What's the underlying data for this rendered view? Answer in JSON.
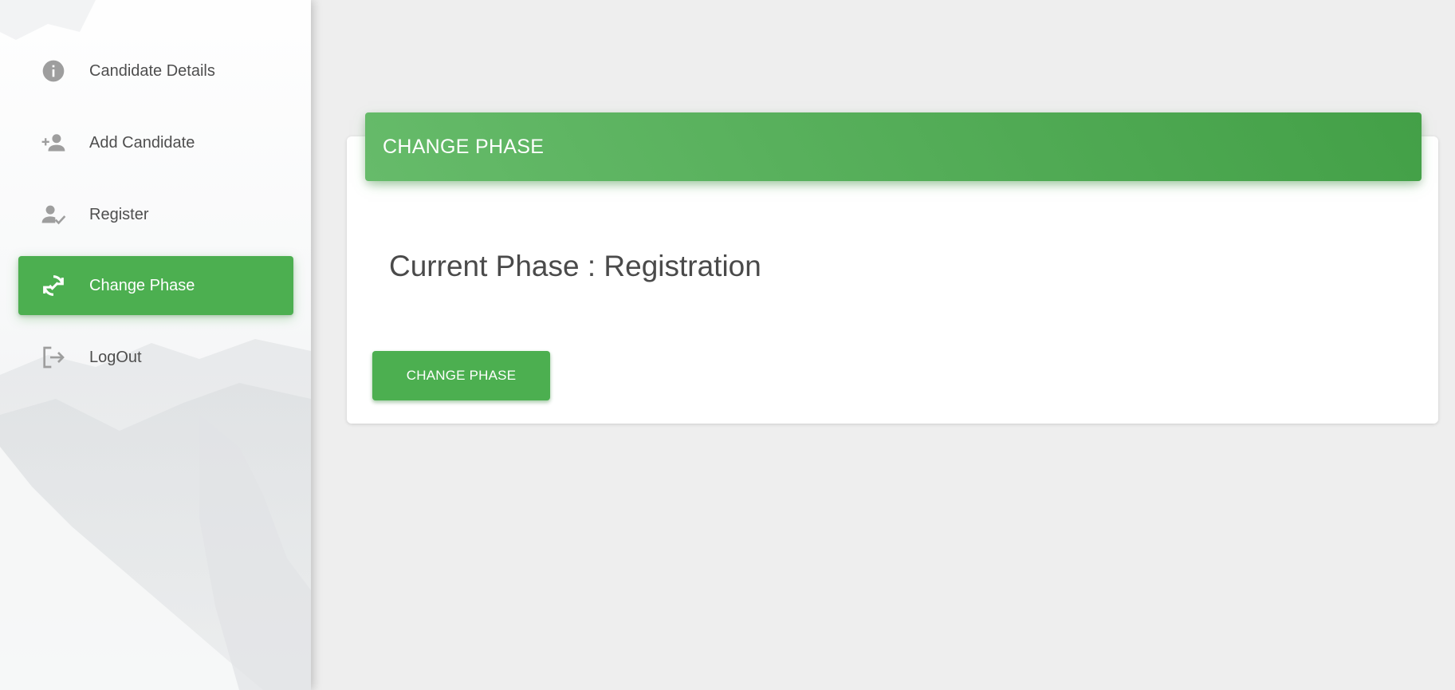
{
  "sidebar": {
    "items": [
      {
        "label": "Candidate Details",
        "icon": "info-icon",
        "active": false
      },
      {
        "label": "Add Candidate",
        "icon": "person-add-icon",
        "active": false
      },
      {
        "label": "Register",
        "icon": "person-check-icon",
        "active": false
      },
      {
        "label": "Change Phase",
        "icon": "sync-check-icon",
        "active": true
      },
      {
        "label": "LogOut",
        "icon": "logout-icon",
        "active": false
      }
    ]
  },
  "card": {
    "header_title": "CHANGE PHASE",
    "current_phase_text": "Current Phase : Registration",
    "button_label": "CHANGE PHASE"
  },
  "colors": {
    "accent": "#4caf50",
    "header_gradient_start": "#66bb6a",
    "header_gradient_end": "#43a047",
    "background": "#eeeeee",
    "icon_gray": "#9e9e9e"
  }
}
